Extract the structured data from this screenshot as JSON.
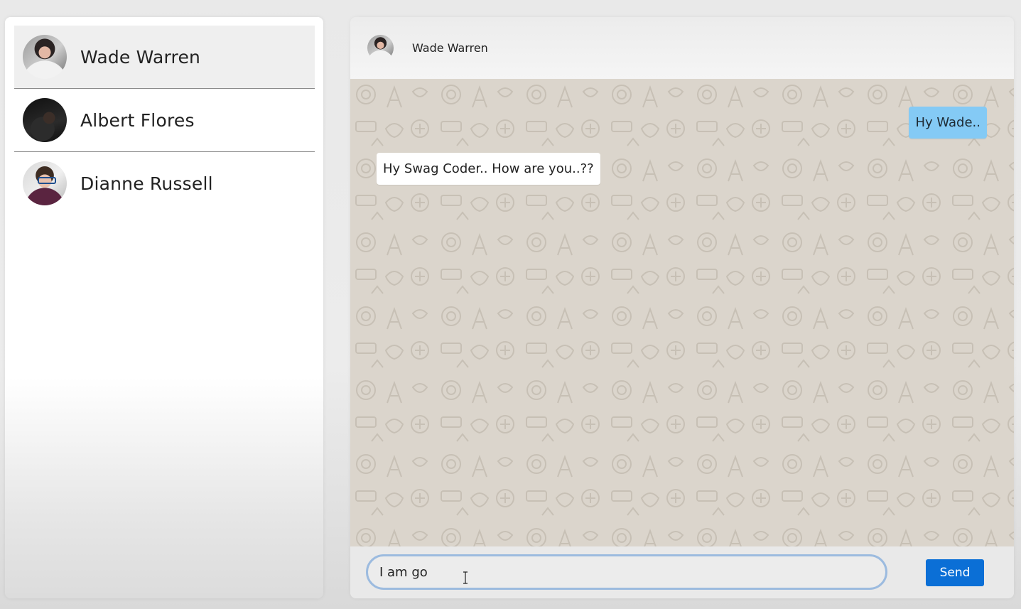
{
  "contacts": [
    {
      "name": "Wade Warren",
      "active": true,
      "avatar_icon": "wade-avatar"
    },
    {
      "name": "Albert Flores",
      "active": false,
      "avatar_icon": "albert-avatar"
    },
    {
      "name": "Dianne Russell",
      "active": false,
      "avatar_icon": "dianne-avatar"
    }
  ],
  "chat": {
    "header_name": "Wade Warren",
    "messages": [
      {
        "direction": "outgoing",
        "text": "Hy Wade.."
      },
      {
        "direction": "incoming",
        "text": "Hy Swag Coder.. How are you..??"
      }
    ],
    "input_value": "I am go",
    "send_label": "Send"
  },
  "colors": {
    "outgoing_bubble": "#84caf5",
    "incoming_bubble": "#ffffff",
    "send_button": "#0b6fd6",
    "input_focus_border": "#9cbbdf",
    "chat_background": "#dbd5cc"
  }
}
